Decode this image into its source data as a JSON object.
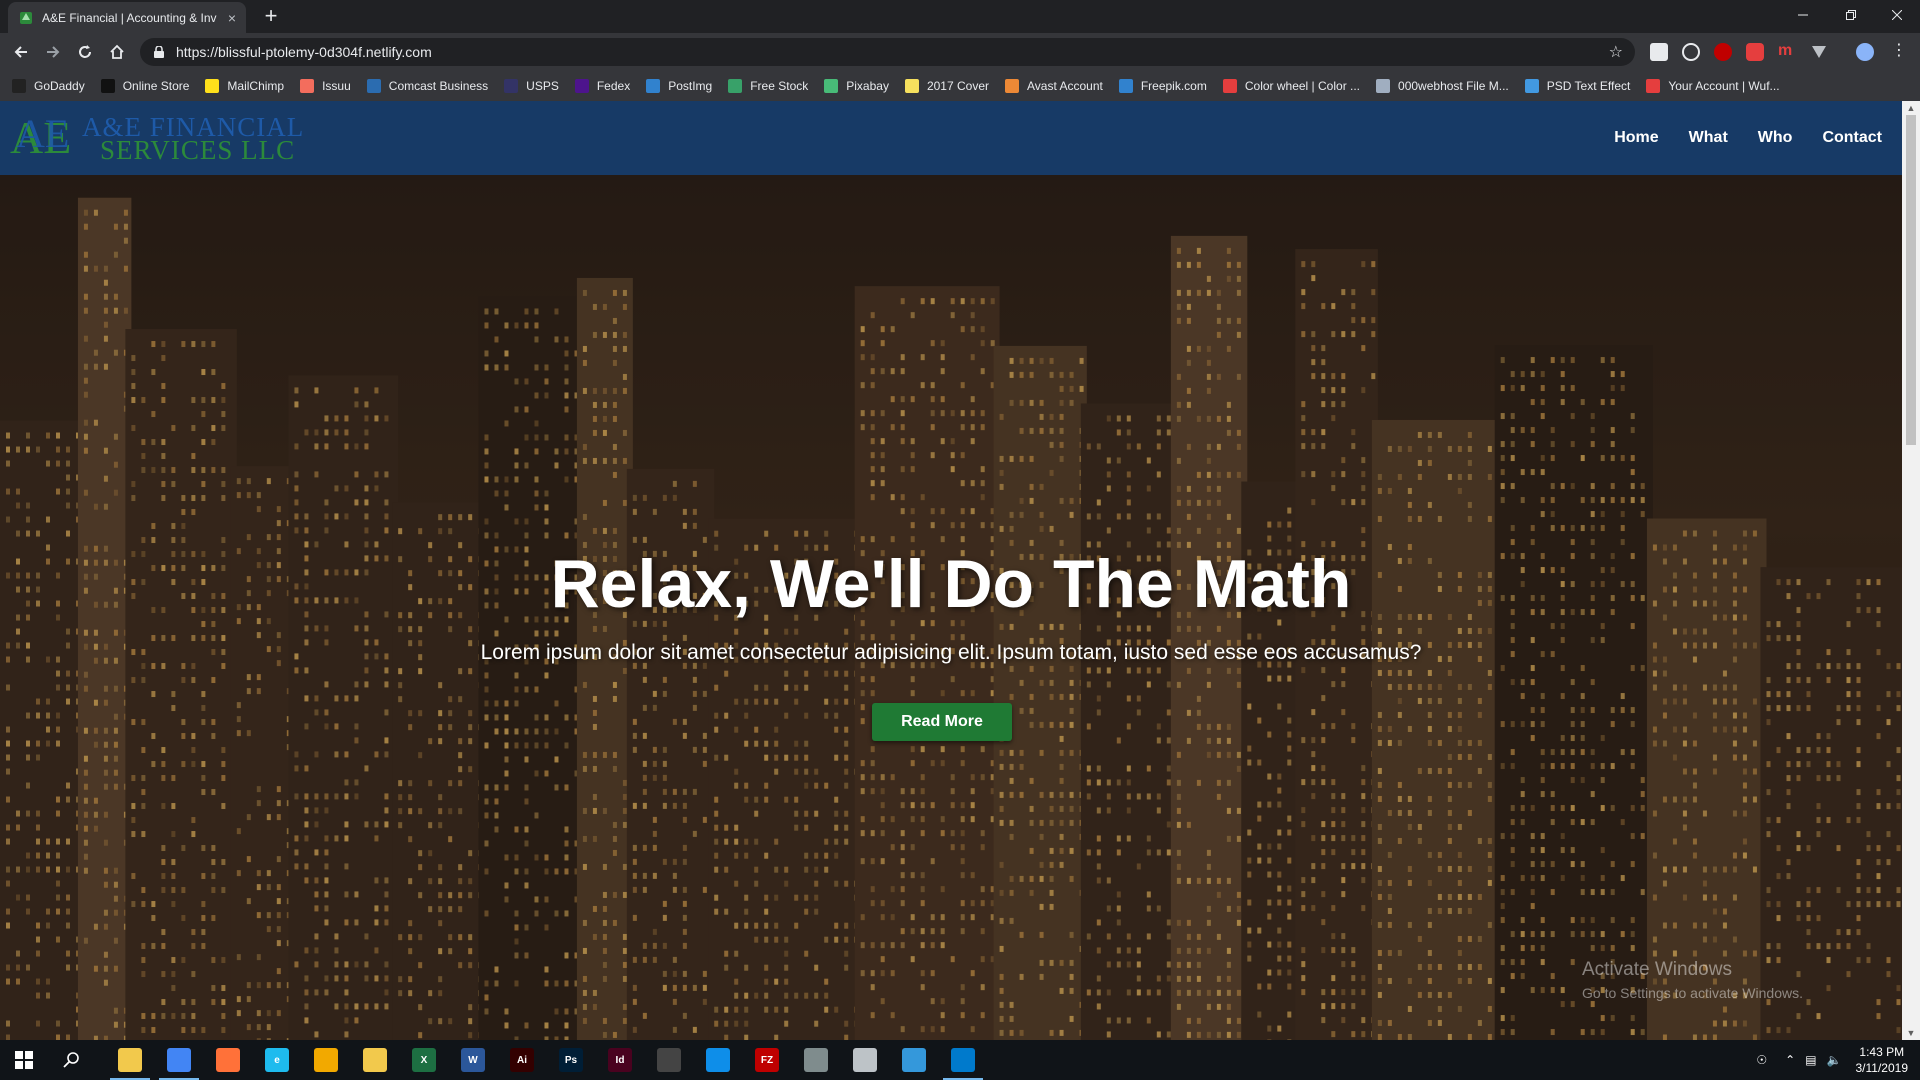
{
  "browser": {
    "tab_title": "A&E Financial | Accounting & Inv",
    "tab_close": "×",
    "new_tab": "+",
    "url": "https://blissful-ptolemy-0d304f.netlify.com",
    "bookmarks": [
      {
        "label": "GoDaddy",
        "color": "#222222"
      },
      {
        "label": "Online Store",
        "color": "#111111"
      },
      {
        "label": "MailChimp",
        "color": "#ffe01b"
      },
      {
        "label": "Issuu",
        "color": "#f36d5d"
      },
      {
        "label": "Comcast Business",
        "color": "#2b6cb0"
      },
      {
        "label": "USPS",
        "color": "#333366"
      },
      {
        "label": "Fedex",
        "color": "#4d148c"
      },
      {
        "label": "PostImg",
        "color": "#3182ce"
      },
      {
        "label": "Free Stock",
        "color": "#38a169"
      },
      {
        "label": "Pixabay",
        "color": "#48bb78"
      },
      {
        "label": "2017 Cover",
        "color": "#f6e05e"
      },
      {
        "label": "Avast Account",
        "color": "#ed8936"
      },
      {
        "label": "Freepik.com",
        "color": "#3182ce"
      },
      {
        "label": "Color wheel | Color ...",
        "color": "#e53e3e"
      },
      {
        "label": "000webhost File M...",
        "color": "#a0aec0"
      },
      {
        "label": "PSD Text Effect",
        "color": "#4299e1"
      },
      {
        "label": "Your Account | Wuf...",
        "color": "#e53e3e"
      }
    ]
  },
  "site": {
    "logo_line1": "A&E FINANCIAL",
    "logo_line2": "SERVICES LLC",
    "logo_mark": "AE",
    "nav": {
      "home": "Home",
      "what": "What",
      "who": "Who",
      "contact": "Contact"
    },
    "hero": {
      "title": "Relax, We'll Do The Math",
      "subtitle": "Lorem ipsum dolor sit amet consectetur adipisicing elit. Ipsum totam, iusto sed esse eos accusamus?",
      "button": "Read More"
    }
  },
  "watermark": {
    "line1": "Activate Windows",
    "line2": "Go to Settings to activate Windows."
  },
  "taskbar": {
    "time": "1:43 PM",
    "date": "3/11/2019",
    "apps": [
      {
        "name": "file-explorer",
        "label": "",
        "color": "#f2c94c"
      },
      {
        "name": "chrome",
        "label": "",
        "color": "#4285f4"
      },
      {
        "name": "firefox",
        "label": "",
        "color": "#ff7139"
      },
      {
        "name": "internet-explorer",
        "label": "e",
        "color": "#1ebbee"
      },
      {
        "name": "app-circle",
        "label": "",
        "color": "#f2a900"
      },
      {
        "name": "mail",
        "label": "",
        "color": "#f2c94c"
      },
      {
        "name": "excel",
        "label": "X",
        "color": "#1d6f42"
      },
      {
        "name": "word",
        "label": "W",
        "color": "#2b579a"
      },
      {
        "name": "illustrator",
        "label": "Ai",
        "color": "#330000"
      },
      {
        "name": "photoshop",
        "label": "Ps",
        "color": "#001e36"
      },
      {
        "name": "indesign",
        "label": "Id",
        "color": "#49021f"
      },
      {
        "name": "calculator",
        "label": "",
        "color": "#444444"
      },
      {
        "name": "teamviewer",
        "label": "",
        "color": "#0e8ee9"
      },
      {
        "name": "filezilla",
        "label": "FZ",
        "color": "#bf0000"
      },
      {
        "name": "app-gray",
        "label": "",
        "color": "#7f8c8d"
      },
      {
        "name": "app-white",
        "label": "",
        "color": "#bdc3c7"
      },
      {
        "name": "app-blue",
        "label": "",
        "color": "#3498db"
      },
      {
        "name": "vscode",
        "label": "",
        "color": "#007acc"
      }
    ]
  }
}
